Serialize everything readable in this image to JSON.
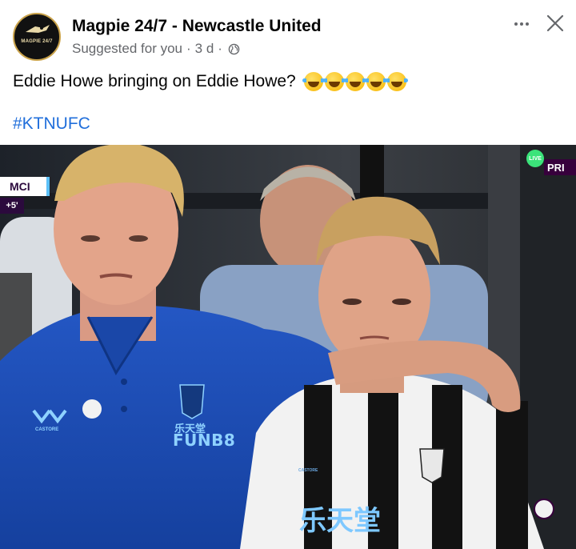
{
  "post": {
    "page_name": "Magpie 24/7 - Newcastle United",
    "avatar_text": "MAGPIE 24/7",
    "suggested": "Suggested for you",
    "separator": "·",
    "time_ago": "3 d",
    "separator2": "·",
    "text": "Eddie Howe bringing on Eddie Howe?",
    "emoji": "😂",
    "emoji_count": 5,
    "hashtag": "#KTNUFC"
  },
  "photo": {
    "scoreboard_team": "MCI",
    "added_time": "+5'",
    "broadcaster_badge": "PRI",
    "live_badge": "LIVE",
    "coach_shirt_sponsor": "FUNB8",
    "coach_shirt_sponsor_cn": "乐天堂",
    "kit_brand": "CASTORE",
    "player_shirt_sponsor": "乐天堂"
  },
  "colors": {
    "link": "#216fdb",
    "meta_text": "#65676b",
    "coach_kit": "#1d4eb8",
    "stripe_dark": "#121212",
    "stripe_light": "#f2f2f2"
  }
}
